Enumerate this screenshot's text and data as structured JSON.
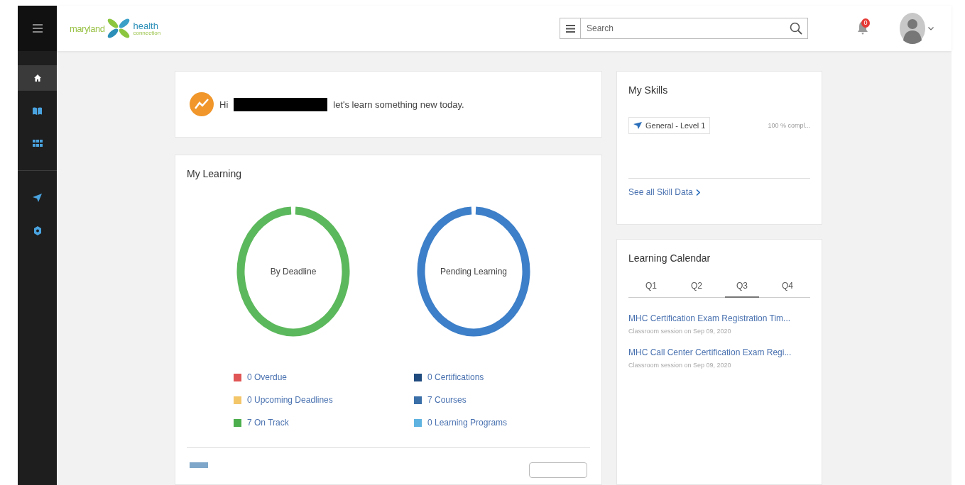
{
  "header": {
    "logo": {
      "word_1": "maryland",
      "word_2": "health",
      "word_3": "connection"
    },
    "search": {
      "placeholder": "Search"
    },
    "notifications": {
      "count": "0"
    }
  },
  "sidebar": {
    "items": [
      {
        "kind": "home",
        "selected": true
      },
      {
        "kind": "book",
        "selected": false
      },
      {
        "kind": "grid",
        "selected": false
      },
      {
        "kind": "plane",
        "selected": false
      },
      {
        "kind": "badge",
        "selected": false
      }
    ]
  },
  "welcome": {
    "greeting": "Hi",
    "message": "let's learn something new today."
  },
  "my_learning": {
    "title": "My Learning",
    "donuts": [
      {
        "label": "By Deadline",
        "color": "#5cb85c",
        "legend": [
          {
            "text": "0 Overdue",
            "color": "#e05555"
          },
          {
            "text": "0 Upcoming Deadlines",
            "color": "#f4c66a"
          },
          {
            "text": "7 On Track",
            "color": "#4cae4c"
          }
        ]
      },
      {
        "label": "Pending Learning",
        "color": "#3d7fc8",
        "legend": [
          {
            "text": "0 Certifications",
            "color": "#1f4b7e"
          },
          {
            "text": "7 Courses",
            "color": "#3a6fa8"
          },
          {
            "text": "0 Learning Programs",
            "color": "#5fb3e0"
          }
        ]
      }
    ]
  },
  "my_skills": {
    "title": "My Skills",
    "skills": [
      {
        "name": "General - Level 1",
        "progress": "100 % compl..."
      }
    ],
    "link": "See all Skill Data"
  },
  "learning_calendar": {
    "title": "Learning Calendar",
    "tabs": [
      {
        "label": "Q1",
        "selected": false
      },
      {
        "label": "Q2",
        "selected": false
      },
      {
        "label": "Q3",
        "selected": true
      },
      {
        "label": "Q4",
        "selected": false
      }
    ],
    "events": [
      {
        "title": "MHC Certification Exam Registration Tim...",
        "detail": "Classroom session on Sep 09, 2020"
      },
      {
        "title": "MHC Call Center Certification Exam Regi...",
        "detail": "Classroom session on Sep 09, 2020"
      }
    ]
  }
}
